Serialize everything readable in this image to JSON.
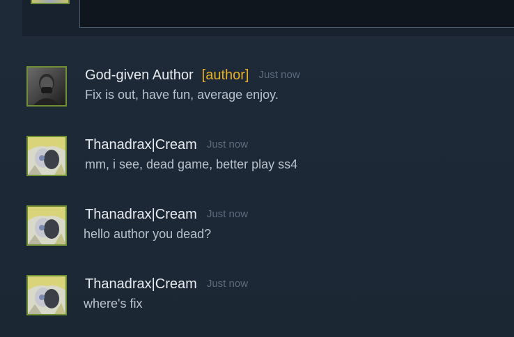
{
  "comments": [
    {
      "author": "God-given Author",
      "badge": "[author]",
      "time": "Just now",
      "text": "Fix is out, have fun, average enjoy."
    },
    {
      "author": "Thanadrax|Cream",
      "time": "Just now",
      "text": "mm, i see, dead game, better play ss4"
    },
    {
      "author": "Thanadrax|Cream",
      "time": "Just now",
      "text": "hello author you dead?"
    },
    {
      "author": "Thanadrax|Cream",
      "time": "Just now",
      "text": "where's fix"
    }
  ],
  "colors": {
    "background": "#1b2838",
    "author_badge": "#e5b021",
    "avatar_border": "#6f8f35",
    "timestamp": "#5d6b7a",
    "body_text": "#b8c2cc"
  }
}
